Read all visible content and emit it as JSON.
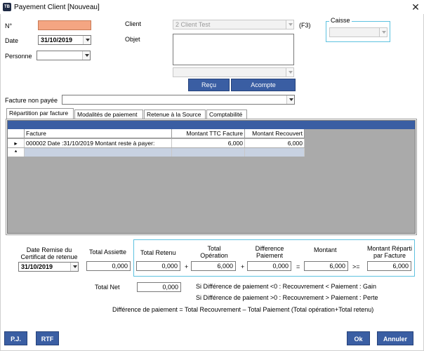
{
  "window": {
    "title": "Payement Client [Nouveau]",
    "icon_text": "TB"
  },
  "fields": {
    "no_label": "N°",
    "no_value": "",
    "date_label": "Date",
    "date_value": "31/10/2019",
    "personne_label": "Personne",
    "personne_value": "",
    "client_label": "Client",
    "client_value": "2 Client Test",
    "client_shortcut": "(F3)",
    "objet_label": "Objet",
    "objet_value": "",
    "objet_combo_value": "",
    "caisse_label": "Caisse",
    "caisse_value": "",
    "facture_label": "Facture non payée",
    "facture_value": ""
  },
  "buttons": {
    "recu": "Reçu",
    "acompte": "Acompte",
    "pj": "P.J.",
    "rtf": "RTF",
    "ok": "Ok",
    "annuler": "Annuler"
  },
  "tabs": [
    {
      "label": "Répartition par facture",
      "active": true
    },
    {
      "label": "Modalités de paiement",
      "active": false
    },
    {
      "label": "Retenue à la Source",
      "active": false
    },
    {
      "label": "Comptabilité",
      "active": false
    }
  ],
  "grid": {
    "columns": [
      "Facture",
      "Montant TTC Facture",
      "Montant Recouvert"
    ],
    "rows": [
      {
        "indicator": "▸",
        "facture": "000002 Date :31/10/2019 Montant reste à payer:",
        "ttc": "6,000",
        "recouvert": "6,000"
      }
    ],
    "new_row_indicator": "*"
  },
  "totals": {
    "date_remise_label": "Date Remise du Certificat de retenue",
    "date_remise_value": "31/10/2019",
    "total_assiette_label": "Total Assiette",
    "total_assiette_value": "0,000",
    "total_retenu_label": "Total Retenu",
    "total_retenu_value": "0,000",
    "plus1": "+",
    "total_operation_label": "Total Opération",
    "total_operation_value": "6,000",
    "plus2": "+",
    "difference_label": "Difference Paiement",
    "difference_value": "0,000",
    "equals": "=",
    "montant_label": "Montant",
    "montant_value": "6,000",
    "gte": ">=",
    "montant_reparti_label": "Montant Réparti par Facture",
    "montant_reparti_value": "6,000",
    "total_net_label": "Total Net",
    "total_net_value": "0,000",
    "rule_negative": "Si Différence de paiement <0 : Recouvrement < Paiement : Gain",
    "rule_positive": "Si Différence de paiement >0 : Recouvrement > Paiement : Perte",
    "rule_formula": "Différence de paiement = Total Recouvrement – Total Paiement (Total opération+Total retenu)"
  },
  "colors": {
    "accent_blue": "#3a5ea3",
    "required_field": "#f4a582",
    "group_border": "#5ec2e0"
  }
}
